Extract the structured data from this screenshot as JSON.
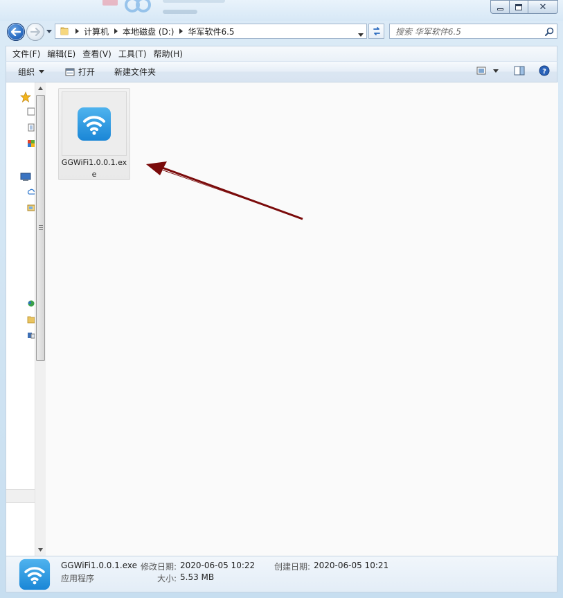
{
  "window": {
    "buttons": {
      "minimize": "minimize",
      "maximize": "maximize",
      "close": "close"
    }
  },
  "address": {
    "crumbs": [
      "计算机",
      "本地磁盘 (D:)",
      "华军软件6.5"
    ]
  },
  "search": {
    "placeholder": "搜索 华军软件6.5"
  },
  "menu": {
    "items": [
      "文件(F)",
      "编辑(E)",
      "查看(V)",
      "工具(T)",
      "帮助(H)"
    ]
  },
  "toolbar": {
    "organize": "组织",
    "open": "打开",
    "new_folder": "新建文件夹"
  },
  "files": [
    {
      "name": "GGWiFi1.0.0.1.exe",
      "icon": "wifi-app-icon",
      "selected": true
    }
  ],
  "details": {
    "name": "GGWiFi1.0.0.1.exe",
    "type": "应用程序",
    "modified_label": "修改日期:",
    "modified_value": "2020-06-05 10:22",
    "created_label": "创建日期:",
    "created_value": "2020-06-05 10:21",
    "size_label": "大小:",
    "size_value": "5.53 MB"
  },
  "colors": {
    "wifi_blue": "#1f8fe0",
    "annotation_arrow": "#7a0a0a"
  }
}
